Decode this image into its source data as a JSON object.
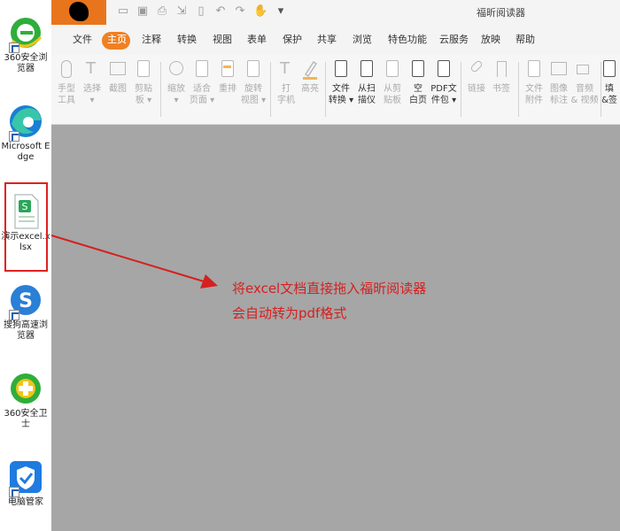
{
  "desktop": {
    "icons": [
      {
        "name": "360-browser",
        "label": "360安全浏览器"
      },
      {
        "name": "edge",
        "label": "Microsoft Edge"
      },
      {
        "name": "excel-file",
        "label": "演示excel.xlsx"
      },
      {
        "name": "sogou-browser",
        "label": "搜狗高速浏览器"
      },
      {
        "name": "360-guard",
        "label": "360安全卫士"
      },
      {
        "name": "pc-manager",
        "label": "电脑管家"
      }
    ]
  },
  "app": {
    "title": "福昕阅读器",
    "menu": [
      "文件",
      "主页",
      "注释",
      "转换",
      "视图",
      "表单",
      "保护",
      "共享",
      "浏览",
      "特色功能",
      "云服务",
      "放映",
      "帮助"
    ],
    "active_menu": "主页",
    "accent_color": "#f08022",
    "tools": [
      {
        "name": "hand-tool",
        "label1": "手型",
        "label2": "工具",
        "enabled": false
      },
      {
        "name": "select-tool",
        "label1": "选择",
        "label2": "▾",
        "enabled": false
      },
      {
        "name": "snapshot",
        "label1": "截图",
        "label2": "",
        "enabled": false
      },
      {
        "name": "clipboard",
        "label1": "剪贴",
        "label2": "板 ▾",
        "enabled": false
      },
      {
        "name": "zoom",
        "label1": "缩放",
        "label2": "▾",
        "enabled": false
      },
      {
        "name": "fit-page",
        "label1": "适合",
        "label2": "页面 ▾",
        "enabled": false
      },
      {
        "name": "reflow",
        "label1": "重排",
        "label2": "",
        "enabled": false
      },
      {
        "name": "rotate-view",
        "label1": "旋转",
        "label2": "视图 ▾",
        "enabled": false
      },
      {
        "name": "typewriter",
        "label1": "打",
        "label2": "字机",
        "enabled": false
      },
      {
        "name": "highlight",
        "label1": "高亮",
        "label2": "",
        "enabled": false
      },
      {
        "name": "file-convert",
        "label1": "文件",
        "label2": "转换 ▾",
        "enabled": true
      },
      {
        "name": "from-scanner",
        "label1": "从扫",
        "label2": "描仪",
        "enabled": true
      },
      {
        "name": "from-clipboard",
        "label1": "从剪",
        "label2": "贴板",
        "enabled": false
      },
      {
        "name": "blank-page",
        "label1": "空",
        "label2": "白页",
        "enabled": true
      },
      {
        "name": "pdf-portfolio",
        "label1": "PDF文",
        "label2": "件包 ▾",
        "enabled": true
      },
      {
        "name": "link",
        "label1": "链接",
        "label2": "",
        "enabled": false
      },
      {
        "name": "bookmark",
        "label1": "书签",
        "label2": "",
        "enabled": false
      },
      {
        "name": "file-attachment",
        "label1": "文件",
        "label2": "附件",
        "enabled": false
      },
      {
        "name": "image-annotation",
        "label1": "图像",
        "label2": "标注",
        "enabled": false
      },
      {
        "name": "audio-video",
        "label1": "音频",
        "label2": "& 视频",
        "enabled": false
      },
      {
        "name": "fill-sign",
        "label1": "填",
        "label2": "&签",
        "enabled": true
      }
    ]
  },
  "annotation": {
    "line1": "将excel文档直接拖入福昕阅读器",
    "line2": "会自动转为pdf格式",
    "color": "#d42020"
  }
}
